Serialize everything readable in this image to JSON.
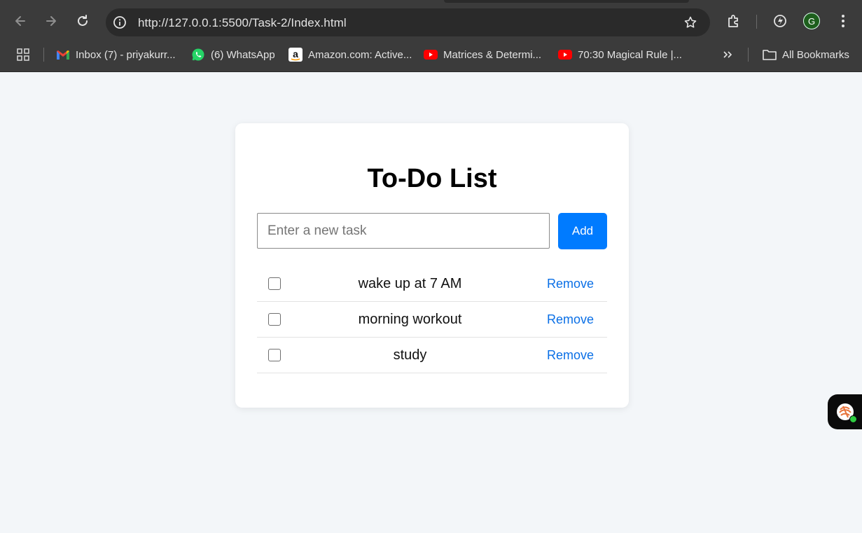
{
  "browser": {
    "url": "http://127.0.0.1:5500/Task-2/Index.html",
    "profile_initial": "G",
    "bookmarks": [
      {
        "label": "Inbox (7) - priyakurr...",
        "icon": "gmail-icon"
      },
      {
        "label": "(6) WhatsApp",
        "icon": "whatsapp-icon"
      },
      {
        "label": "Amazon.com: Active...",
        "icon": "amazon-icon"
      },
      {
        "label": "Matrices & Determi...",
        "icon": "youtube-icon"
      },
      {
        "label": "70:30 Magical Rule |...",
        "icon": "youtube-icon"
      }
    ],
    "all_bookmarks_label": "All Bookmarks"
  },
  "app": {
    "title": "To-Do List",
    "input_placeholder": "Enter a new task",
    "add_label": "Add",
    "tasks": [
      {
        "text": "wake up at 7 AM",
        "done": false,
        "remove_label": "Remove"
      },
      {
        "text": "morning workout",
        "done": false,
        "remove_label": "Remove"
      },
      {
        "text": "study",
        "done": false,
        "remove_label": "Remove"
      }
    ]
  },
  "colors": {
    "accent": "#007bff",
    "link": "#0a6fe6",
    "page_bg": "#f3f6f9",
    "chrome_bg": "#3b3b3b"
  }
}
